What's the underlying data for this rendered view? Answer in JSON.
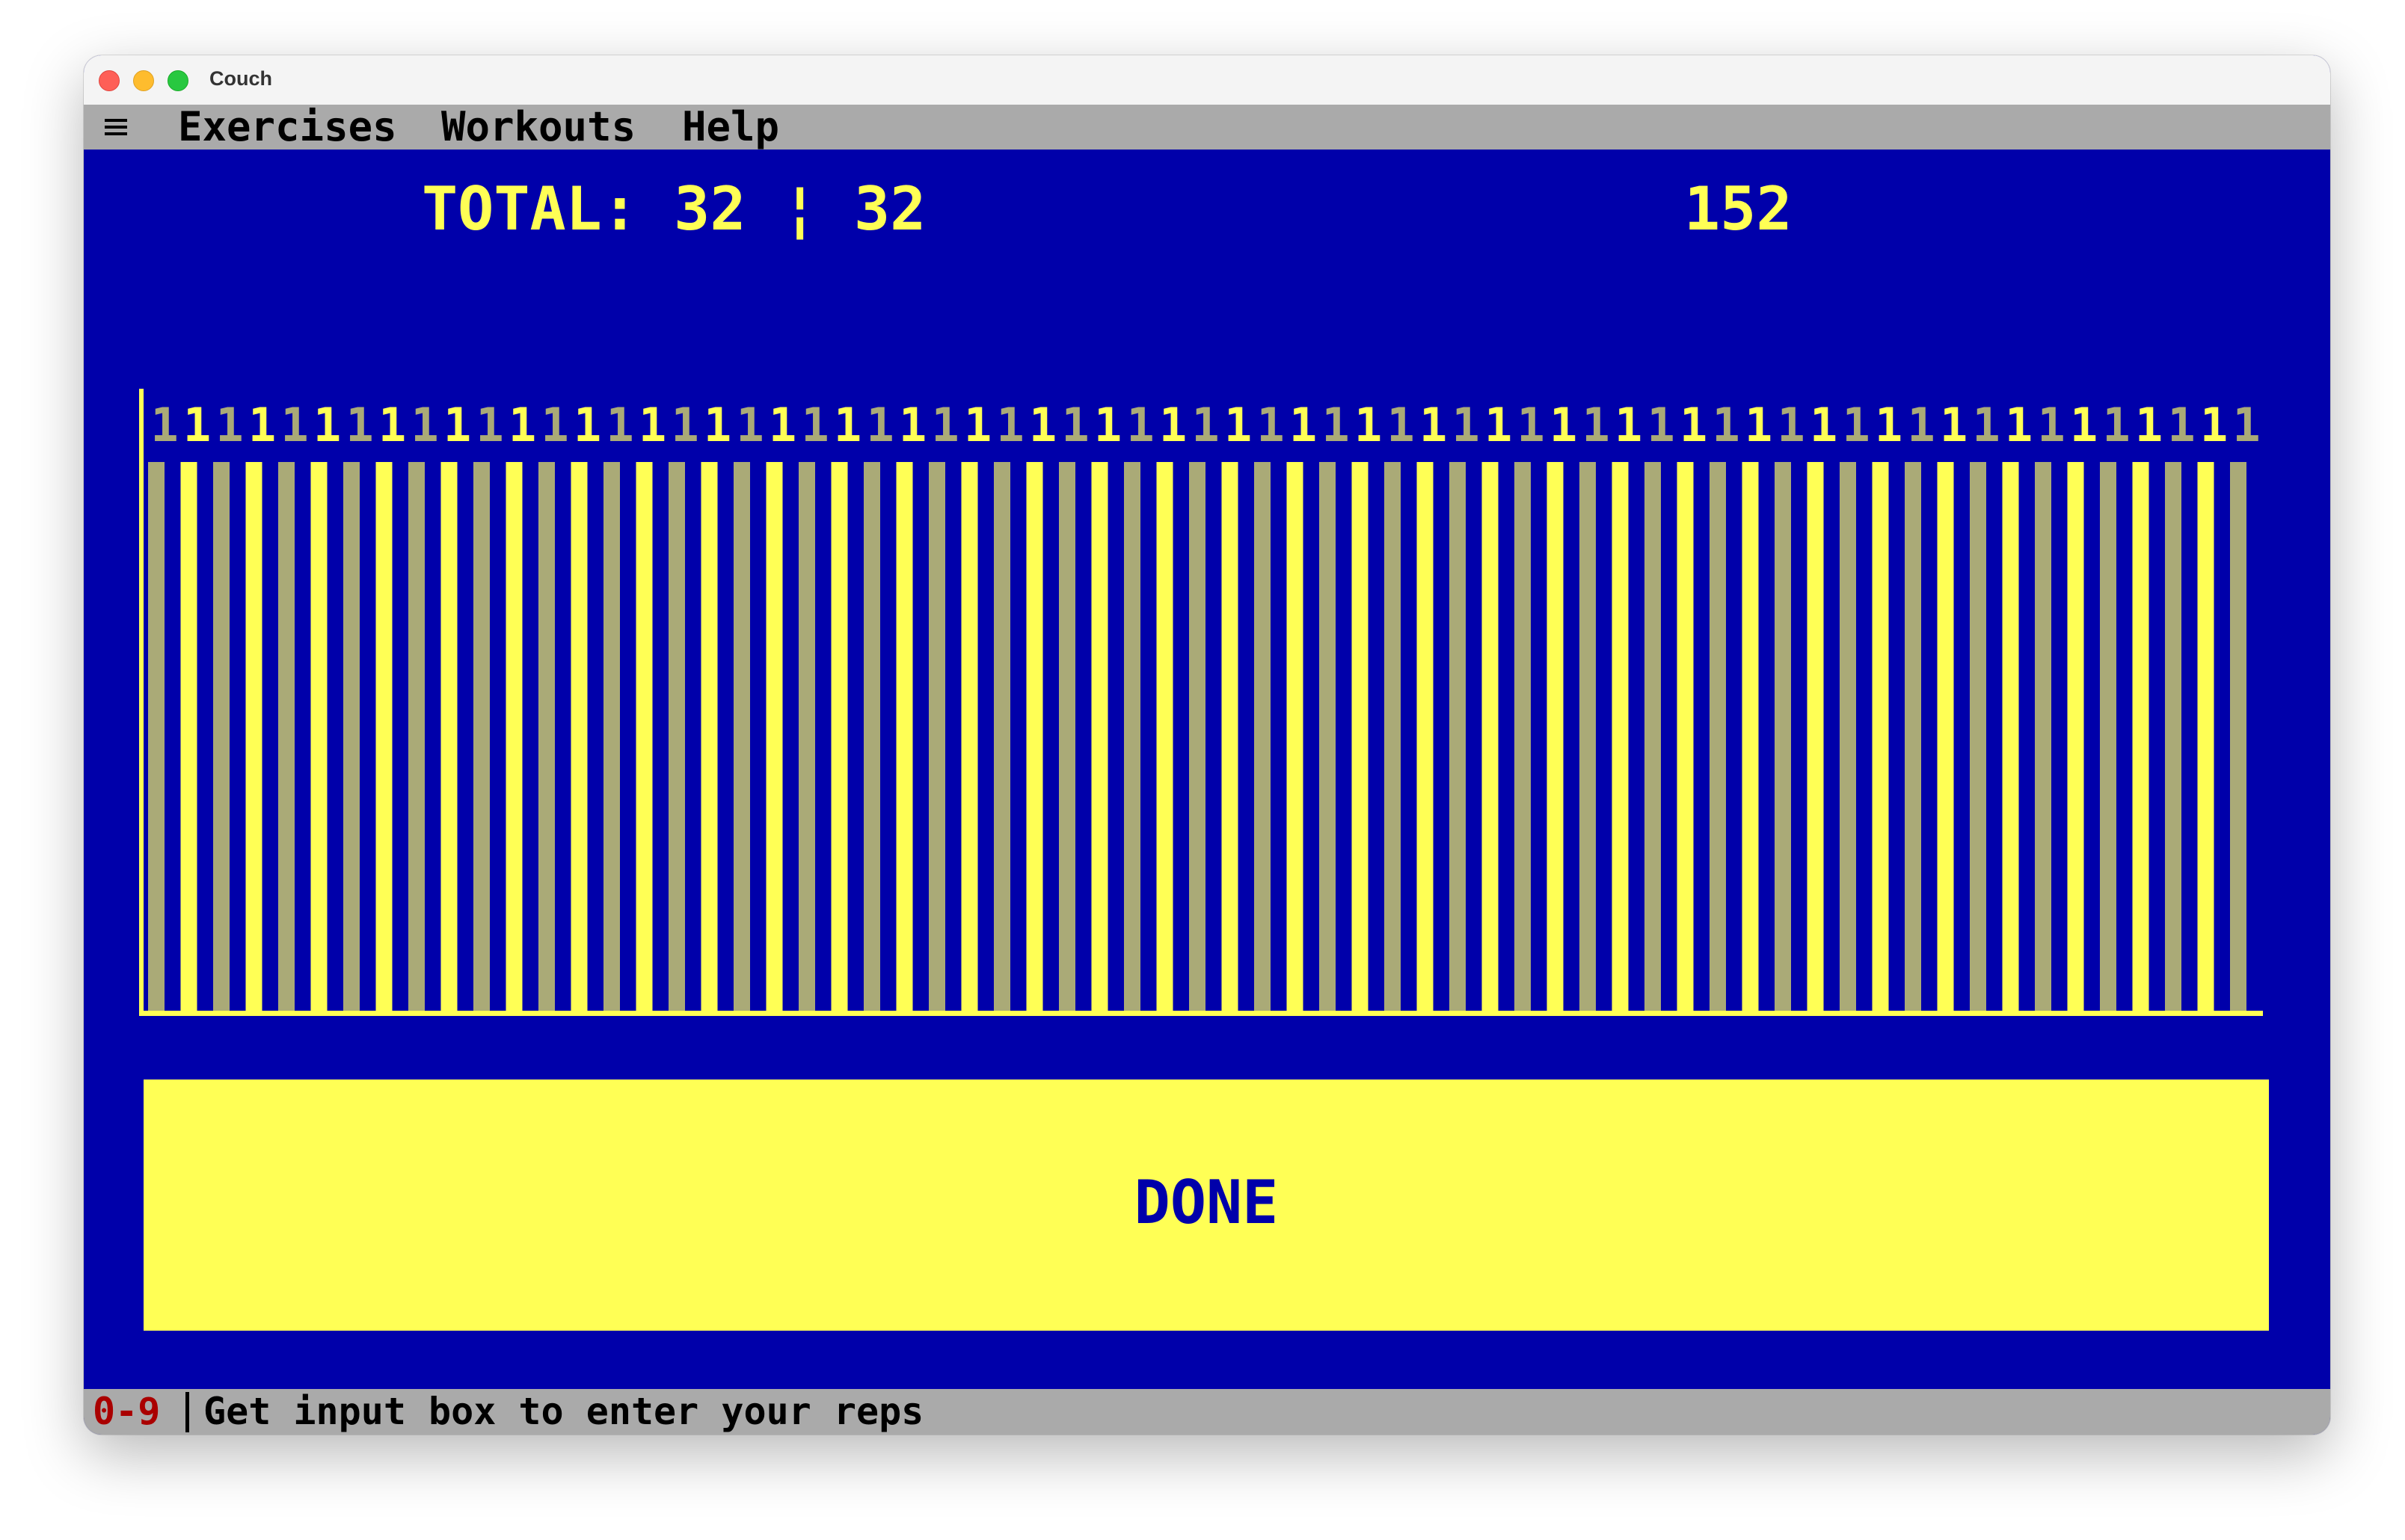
{
  "window": {
    "title": "Couch"
  },
  "menu": {
    "hamburger_icon": "hamburger-menu-icon",
    "items": [
      {
        "label": "Exercises"
      },
      {
        "label": "Workouts"
      },
      {
        "label": "Help"
      }
    ]
  },
  "header": {
    "total_text": "TOTAL: 32 ¦ 32",
    "right_count": "152"
  },
  "colors": {
    "background": "#0000aa",
    "accent": "#ffff55",
    "bar_alt": "#aaaa77",
    "menu_bg": "#aaaaaa",
    "key_red": "#aa0000"
  },
  "chart_data": {
    "type": "bar",
    "values": [
      1,
      1,
      1,
      1,
      1,
      1,
      1,
      1,
      1,
      1,
      1,
      1,
      1,
      1,
      1,
      1,
      1,
      1,
      1,
      1,
      1,
      1,
      1,
      1,
      1,
      1,
      1,
      1,
      1,
      1,
      1,
      1,
      1,
      1,
      1,
      1,
      1,
      1,
      1,
      1,
      1,
      1,
      1,
      1,
      1,
      1,
      1,
      1,
      1,
      1,
      1,
      1,
      1,
      1,
      1,
      1,
      1,
      1,
      1,
      1,
      1,
      1,
      1,
      1,
      1
    ],
    "data_labels": [
      "1",
      "1",
      "1",
      "1",
      "1",
      "1",
      "1",
      "1",
      "1",
      "1",
      "1",
      "1",
      "1",
      "1",
      "1",
      "1",
      "1",
      "1",
      "1",
      "1",
      "1",
      "1",
      "1",
      "1",
      "1",
      "1",
      "1",
      "1",
      "1",
      "1",
      "1",
      "1",
      "1",
      "1",
      "1",
      "1",
      "1",
      "1",
      "1",
      "1",
      "1",
      "1",
      "1",
      "1",
      "1",
      "1",
      "1",
      "1",
      "1",
      "1",
      "1",
      "1",
      "1",
      "1",
      "1",
      "1",
      "1",
      "1",
      "1",
      "1",
      "1",
      "1",
      "1",
      "1",
      "1"
    ],
    "bar_colors": [
      "#aaaa77",
      "#ffff55"
    ],
    "ylim": [
      0,
      1
    ]
  },
  "done_button": {
    "label": "DONE"
  },
  "status_bar": {
    "key": "0-9",
    "text": "Get input box to enter your reps"
  }
}
